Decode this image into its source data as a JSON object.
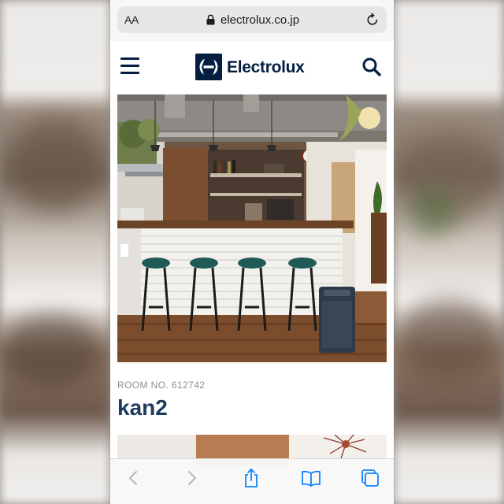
{
  "browser": {
    "text_size_label": "AA",
    "url": "electrolux.co.jp",
    "accent_color": "#0a84ff"
  },
  "site": {
    "brand_name": "Electrolux",
    "brand_color": "#041e42"
  },
  "room": {
    "number_label": "ROOM NO. 612742",
    "title": "kan2",
    "title_color": "#1d3a5f"
  },
  "icons": {
    "menu": "hamburger-menu-icon",
    "search": "magnifier-search-icon",
    "lock": "padlock-icon",
    "reload": "reload-arrow-icon",
    "back": "chevron-left-icon",
    "forward": "chevron-right-icon",
    "share": "share-box-arrow-icon",
    "bookmarks": "open-book-icon",
    "tabs": "overlapping-squares-icon"
  }
}
